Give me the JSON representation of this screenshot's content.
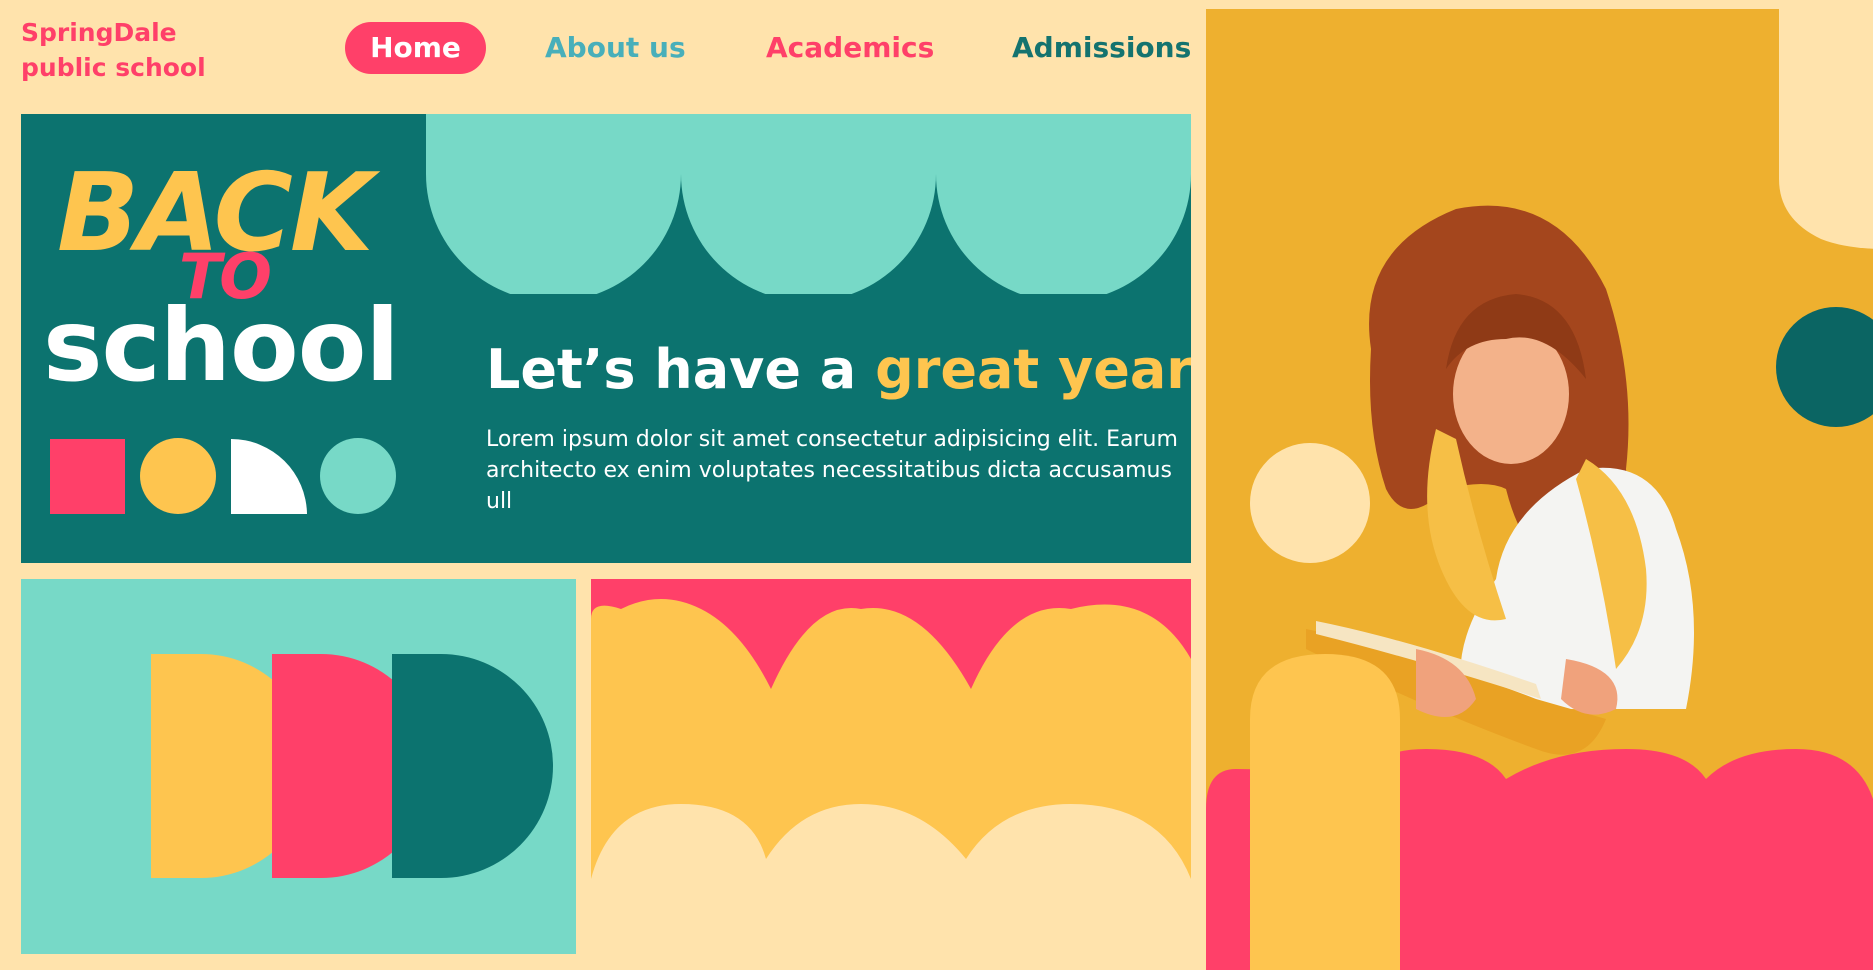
{
  "brand": {
    "line1": "SpringDale",
    "line2": "public school"
  },
  "nav": {
    "home": "Home",
    "about": "About us",
    "academics": "Academics",
    "admissions": "Admissions"
  },
  "hero": {
    "back": "BACK",
    "to": "TO",
    "school": "school",
    "tagline_prefix": "Let’s have a ",
    "tagline_highlight": "great year!",
    "description": "Lorem ipsum dolor sit amet consectetur adipisicing elit. Earum architecto ex enim voluptates necessitatibus dicta accusamus ull"
  },
  "colors": {
    "background": "#FFE3AC",
    "pink": "#FF4069",
    "teal_dark": "#0C736F",
    "teal_light": "#77D9C7",
    "yellow": "#FEC54F",
    "mustard": "#EEB02F"
  }
}
